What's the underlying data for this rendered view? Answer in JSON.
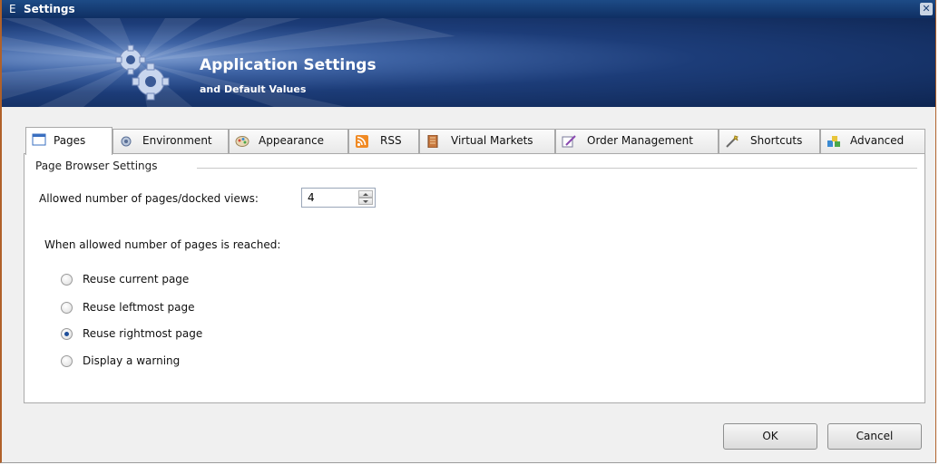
{
  "window": {
    "app_letter": "E",
    "title": "Settings",
    "close_glyph": "✕"
  },
  "banner": {
    "title": "Application Settings",
    "subtitle": "and Default Values",
    "icon": "gears-icon"
  },
  "tabs": [
    {
      "label": "Pages",
      "icon": "pages-icon",
      "active": true
    },
    {
      "label": "Environment",
      "icon": "environment-icon",
      "active": false
    },
    {
      "label": "Appearance",
      "icon": "appearance-icon",
      "active": false
    },
    {
      "label": "RSS",
      "icon": "rss-icon",
      "active": false
    },
    {
      "label": "Virtual Markets",
      "icon": "virtual-markets-icon",
      "active": false
    },
    {
      "label": "Order Management",
      "icon": "order-management-icon",
      "active": false
    },
    {
      "label": "Shortcuts",
      "icon": "shortcuts-icon",
      "active": false
    },
    {
      "label": "Advanced",
      "icon": "advanced-icon",
      "active": false
    }
  ],
  "page_browser": {
    "group_title": "Page Browser Settings",
    "allowed_label": "Allowed number of pages/docked views:",
    "allowed_value": "4",
    "when_label": "When allowed number of pages is reached:",
    "options": [
      {
        "label": "Reuse current page",
        "checked": false
      },
      {
        "label": "Reuse leftmost page",
        "checked": false
      },
      {
        "label": "Reuse rightmost page",
        "checked": true
      },
      {
        "label": "Display a warning",
        "checked": false
      }
    ]
  },
  "footer": {
    "ok_label": "OK",
    "cancel_label": "Cancel"
  },
  "colors": {
    "titlebar": "#1d4b86",
    "banner_dark": "#0e2551",
    "window_border": "#b0612a",
    "radio_dot": "#1f4f9a"
  }
}
